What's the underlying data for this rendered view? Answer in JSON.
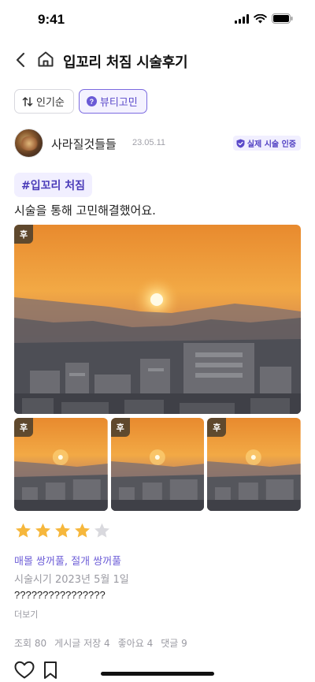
{
  "status_bar": {
    "time": "9:41"
  },
  "header": {
    "back_icon": "chevron-left-icon",
    "home_icon": "home-icon",
    "title": "입꼬리 처짐 시술후기"
  },
  "filters": {
    "sort_label": "인기순",
    "sort_icon": "sort-arrows-icon",
    "category_label": "뷰티고민",
    "category_icon": "question-circle-icon"
  },
  "author": {
    "name": "사라질것들들",
    "date": "23.05.11",
    "verified_label": "실제 시술 인증",
    "verified_icon": "shield-check-icon"
  },
  "post": {
    "tag": "#입꼬리 처짐",
    "text": "시술을 통해 고민해결했어요.",
    "photo_label": "후",
    "thumb_labels": [
      "후",
      "후",
      "후"
    ]
  },
  "review": {
    "rating": 4,
    "max_rating": 5,
    "treatments": "매몰 쌍꺼풀, 절개 쌍꺼풀",
    "treatment_date": "시술시기 2023년 5월 1일",
    "body": "????????????????",
    "more_label": "더보기"
  },
  "stats": {
    "views": "조회 80",
    "saves": "게시글 저장 4",
    "likes": "좋아요 4",
    "comments": "댓글 9"
  },
  "actions": {
    "like_icon": "heart-icon",
    "bookmark_icon": "bookmark-icon"
  },
  "colors": {
    "accent": "#6a5ad6",
    "star": "#f6b73c",
    "star_empty": "#d9d9de",
    "muted": "#9a9aa2"
  }
}
